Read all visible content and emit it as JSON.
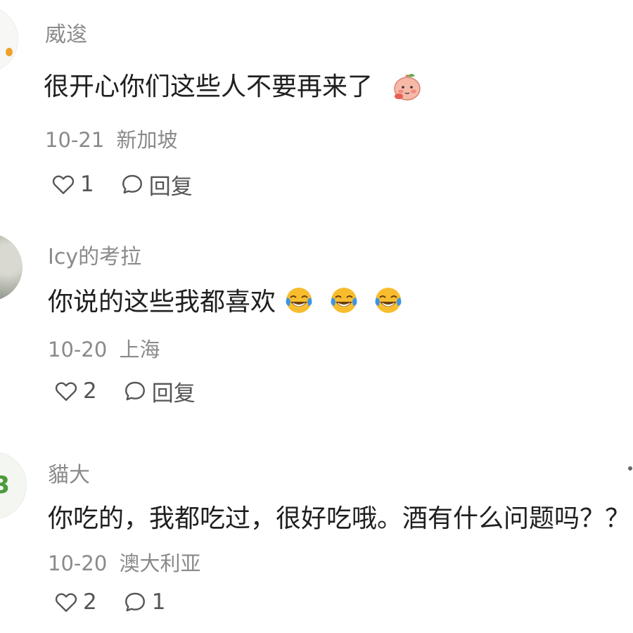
{
  "comments": [
    {
      "username": "威逡",
      "text": "很开心你们这些人不要再来了",
      "emoji": "peach-shy-emoji",
      "date": "10-21",
      "location": "新加坡",
      "likes": "1",
      "reply_label": "回复"
    },
    {
      "username": "Icy的考拉",
      "text": "你说的这些我都喜欢",
      "emoji": "tears-of-joy-emoji",
      "date": "10-20",
      "location": "上海",
      "likes": "2",
      "reply_label": "回复"
    },
    {
      "username": "貓大",
      "text": "你吃的，我都吃过，很好吃哦。酒有什么问题吗？？",
      "date": "10-20",
      "location": "澳大利亚",
      "likes": "2",
      "replies": "1"
    }
  ],
  "colors": {
    "username": "#8a8a8a",
    "text": "#1f1f1f",
    "meta": "#8a8a8a",
    "action": "#555555",
    "background": "#ffffff"
  }
}
